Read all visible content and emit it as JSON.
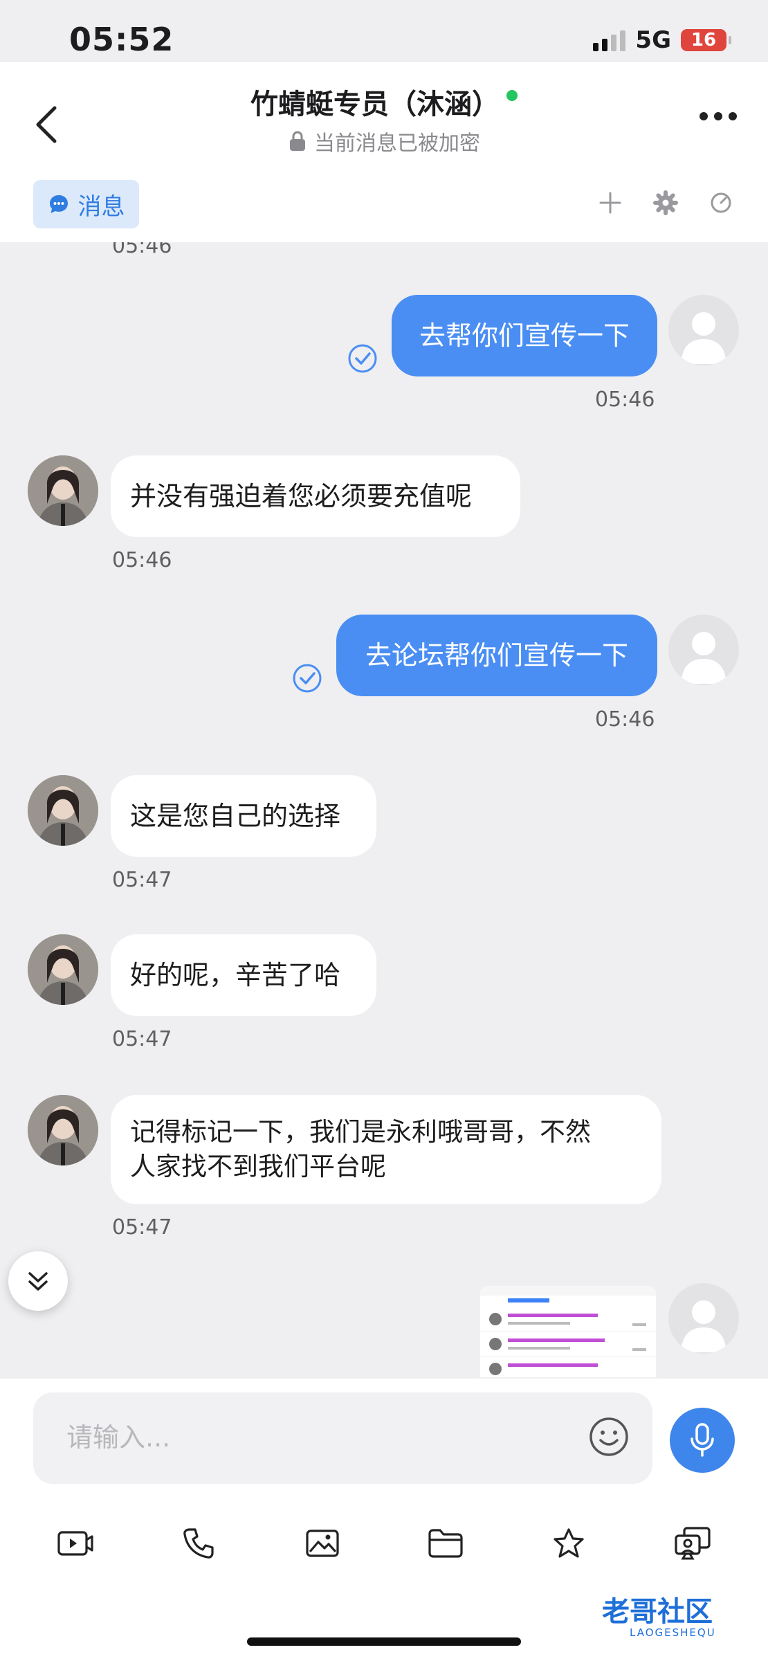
{
  "status": {
    "time": "05:52",
    "network": "5G",
    "battery": "16"
  },
  "header": {
    "title": "竹蜻蜓专员（沐涵）",
    "subtitle": "当前消息已被加密",
    "tab_label": "消息"
  },
  "messages": [
    {
      "side": "out",
      "text": "去帮你们宣传一下",
      "time": "05:46"
    },
    {
      "side": "in",
      "text": "并没有强迫着您必须要充值呢",
      "time": "05:46"
    },
    {
      "side": "out",
      "text": "去论坛帮你们宣传一下",
      "time": "05:46"
    },
    {
      "side": "in",
      "text": "这是您自己的选择",
      "time": "05:47"
    },
    {
      "side": "in",
      "text": "好的呢，辛苦了哈",
      "time": "05:47"
    },
    {
      "side": "in",
      "text_line1": "记得标记一下，我们是永利哦哥哥，不然",
      "text_line2": "人家找不到我们平台呢",
      "time": "05:47"
    }
  ],
  "input": {
    "placeholder": "请输入..."
  },
  "toolbar": [
    "video-icon",
    "phone-icon",
    "image-icon",
    "folder-icon",
    "star-icon",
    "screen-share-icon"
  ],
  "watermark": {
    "text": "老哥社区",
    "sub": "LAOGESHEQU"
  },
  "colors": {
    "accent": "#4a8ef3",
    "online": "#22c55e",
    "battery": "#e0453d"
  }
}
